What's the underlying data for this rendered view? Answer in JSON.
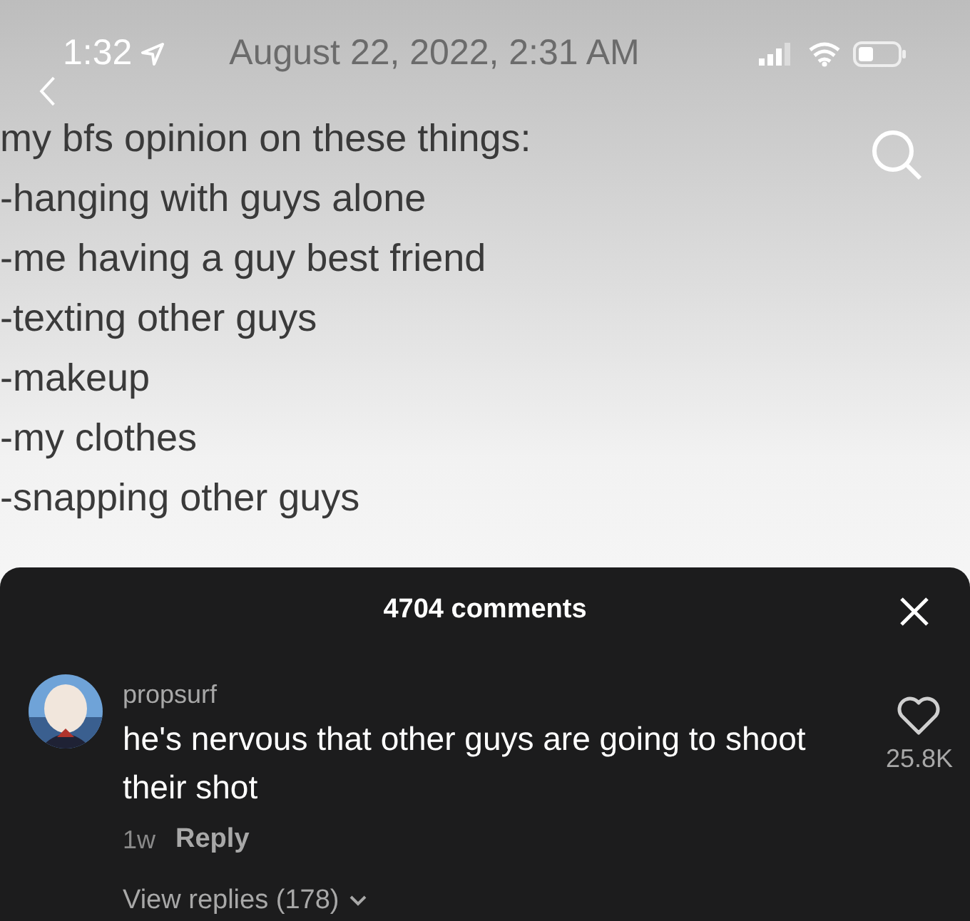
{
  "status_bar": {
    "time": "1:32",
    "date": "August 22, 2022, 2:31 AM"
  },
  "post_lines": [
    "my bfs opinion on these things:",
    "-hanging with guys alone",
    "-me having a guy best friend",
    "-texting other guys",
    "-makeup",
    "-my clothes",
    "-snapping other guys"
  ],
  "comments_panel": {
    "title": "4704 comments",
    "comments": [
      {
        "username": "propsurf",
        "text": "he's nervous that other guys are going to shoot their shot",
        "like_count": "25.8K",
        "liked": false,
        "age": "1w",
        "reply_label": "Reply",
        "view_replies": "View replies (178)"
      }
    ]
  }
}
